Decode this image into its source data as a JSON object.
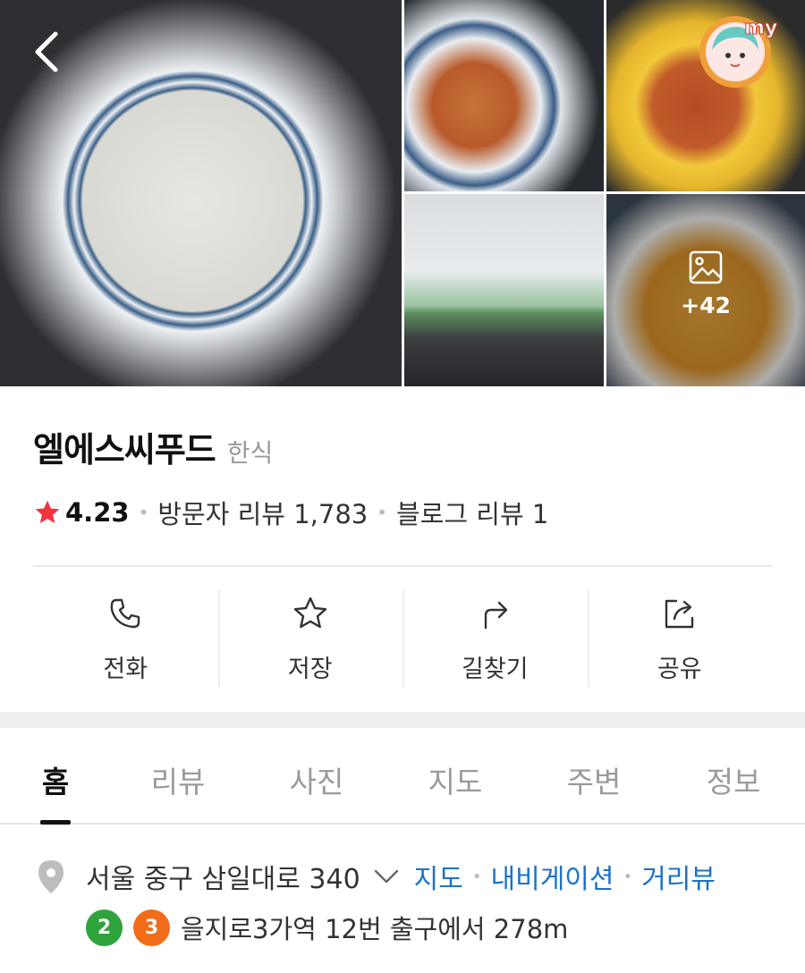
{
  "gallery": {
    "more_count": "+42",
    "photos": [
      "main-photo",
      "side-dish-photo",
      "noodle-photo",
      "cafeteria-photo",
      "curry-photo"
    ],
    "my_badge": "my"
  },
  "place": {
    "name": "엘에스씨푸드",
    "category": "한식",
    "rating": "4.23",
    "visitor_reviews": "방문자 리뷰 1,783",
    "blog_reviews": "블로그 리뷰 1"
  },
  "actions": [
    {
      "label": "전화",
      "icon": "phone-icon"
    },
    {
      "label": "저장",
      "icon": "star-outline-icon"
    },
    {
      "label": "길찾기",
      "icon": "directions-icon"
    },
    {
      "label": "공유",
      "icon": "share-icon"
    }
  ],
  "tabs": [
    "홈",
    "리뷰",
    "사진",
    "지도",
    "주변",
    "정보"
  ],
  "active_tab": "홈",
  "address": {
    "text": "서울 중구 삼일대로 340",
    "links": [
      "지도",
      "내비게이션",
      "거리뷰"
    ]
  },
  "subway": {
    "lines": [
      "2",
      "3"
    ],
    "line_colors": [
      "#2fa33c",
      "#f26c1a"
    ],
    "text": "을지로3가역 12번 출구에서 278m"
  },
  "colors": {
    "link": "#1a73c8",
    "star": "#f5323f"
  }
}
